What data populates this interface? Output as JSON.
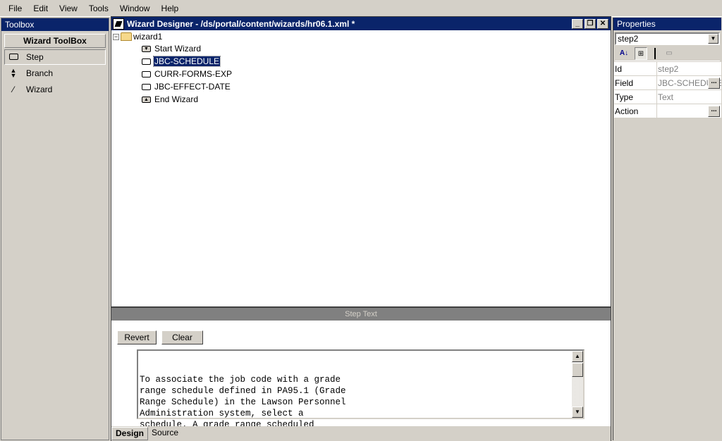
{
  "menu": [
    "File",
    "Edit",
    "View",
    "Tools",
    "Window",
    "Help"
  ],
  "toolbox": {
    "title": "Toolbox",
    "header": "Wizard ToolBox",
    "items": [
      {
        "label": "Step",
        "icon": "step-icon"
      },
      {
        "label": "Branch",
        "icon": "branch-icon"
      },
      {
        "label": "Wizard",
        "icon": "wand-icon"
      }
    ]
  },
  "designer": {
    "title": "Wizard Designer - /ds/portal/content/wizards/hr06.1.xml *",
    "root": "wizard1",
    "nodes": [
      "Start Wizard",
      "JBC-SCHEDULE",
      "CURR-FORMS-EXP",
      "JBC-EFFECT-DATE",
      "End Wizard"
    ],
    "selected_node": "JBC-SCHEDULE",
    "step_text_label": "Step Text",
    "revert_label": "Revert",
    "clear_label": "Clear",
    "step_text": "\nTo associate the job code with a grade\nrange schedule defined in PA95.1 (Grade\nRange Schedule) in the Lawson Personnel\nAdministration system, select a\nschedule. A grade range scheduled",
    "tabs": [
      "Design",
      "Source"
    ],
    "active_tab": "Design"
  },
  "properties": {
    "title": "Properties",
    "selected_object": "step2",
    "rows": [
      {
        "key": "Id",
        "value": "step2"
      },
      {
        "key": "Field",
        "value": "JBC-SCHEDULE"
      },
      {
        "key": "Type",
        "value": "Text"
      },
      {
        "key": "Action",
        "value": ""
      }
    ]
  }
}
